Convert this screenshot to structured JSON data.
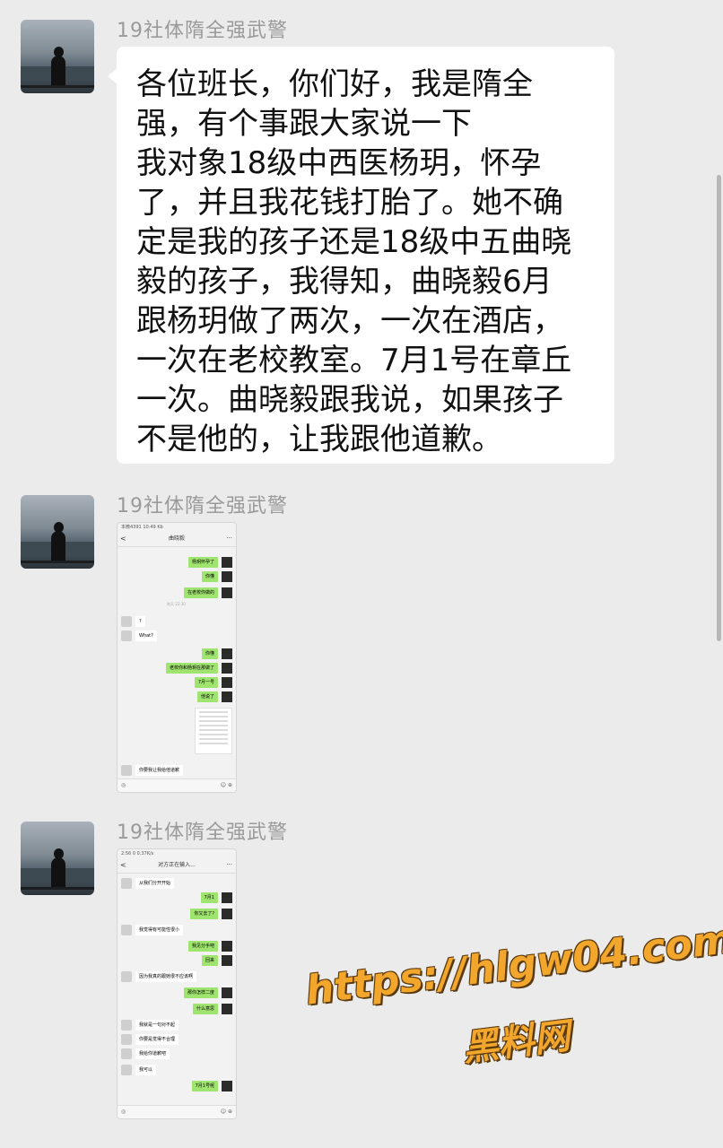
{
  "messages": [
    {
      "sender": "19社体隋全强武警",
      "type": "text",
      "text": "各位班长，你们好，我是隋全\n强，有个事跟大家说一下\n我对象18级中西医杨玥，怀孕\n了，并且我花钱打胎了。她不确\n定是我的孩子还是18级中五曲晓\n毅的孩子，我得知，曲晓毅6月\n跟杨玥做了两次，一次在酒店，\n一次在老校教室。7月1号在章丘\n一次。曲晓毅跟我说，如果孩子\n不是他的，让我跟他道歉。"
    },
    {
      "sender": "19社体隋全强武警",
      "type": "image",
      "screenshot": {
        "status": "本微4391 10:49 Kb",
        "title": "曲晓毅",
        "more": "···",
        "back": "<",
        "time_label": "昨天 22:30",
        "lines": [
          {
            "side": "right",
            "text": "杨玥怀孕了"
          },
          {
            "side": "right",
            "text": "你懂"
          },
          {
            "side": "right",
            "text": "在老校你做的"
          },
          {
            "side": "left",
            "text": "?"
          },
          {
            "side": "left",
            "text": "What?"
          },
          {
            "side": "right",
            "text": "你懂"
          },
          {
            "side": "right",
            "text": "老校你和杨玥在那做了"
          },
          {
            "side": "right",
            "text": "7月一号"
          },
          {
            "side": "right",
            "text": "他说了"
          },
          {
            "side": "left",
            "text": "你要我让我给他道歉"
          }
        ],
        "input_left": "◎",
        "input_right": "☺ ⊕"
      }
    },
    {
      "sender": "19社体隋全强武警",
      "type": "image",
      "screenshot": {
        "status": "2:56 0 0.37K/s",
        "title": "对方正在输入...",
        "more": "···",
        "back": "<",
        "lines": [
          {
            "side": "left",
            "text": "从我们分开开始"
          },
          {
            "side": "right",
            "text": "7月1"
          },
          {
            "side": "right",
            "text": "你又去了?"
          },
          {
            "side": "left",
            "text": "我觉得有可能性很小"
          },
          {
            "side": "right",
            "text": "我见分手吧"
          },
          {
            "side": "right",
            "text": "回来"
          },
          {
            "side": "left",
            "text": "因为我真的跟她很不应该啊"
          },
          {
            "side": "right",
            "text": "那你怎样二度"
          },
          {
            "side": "right",
            "text": "什么意思"
          },
          {
            "side": "left",
            "text": "我就是一句对不起"
          },
          {
            "side": "left",
            "text": "你要是觉得不合理"
          },
          {
            "side": "left",
            "text": "我给你道歉吧"
          },
          {
            "side": "left",
            "text": "我可以"
          },
          {
            "side": "right",
            "text": "7月1号呢"
          }
        ],
        "input_left": "◎",
        "input_right": "☺ ⊕"
      }
    }
  ],
  "watermark": {
    "line1": "https://hlgw04.com",
    "line2": "黑料网"
  }
}
